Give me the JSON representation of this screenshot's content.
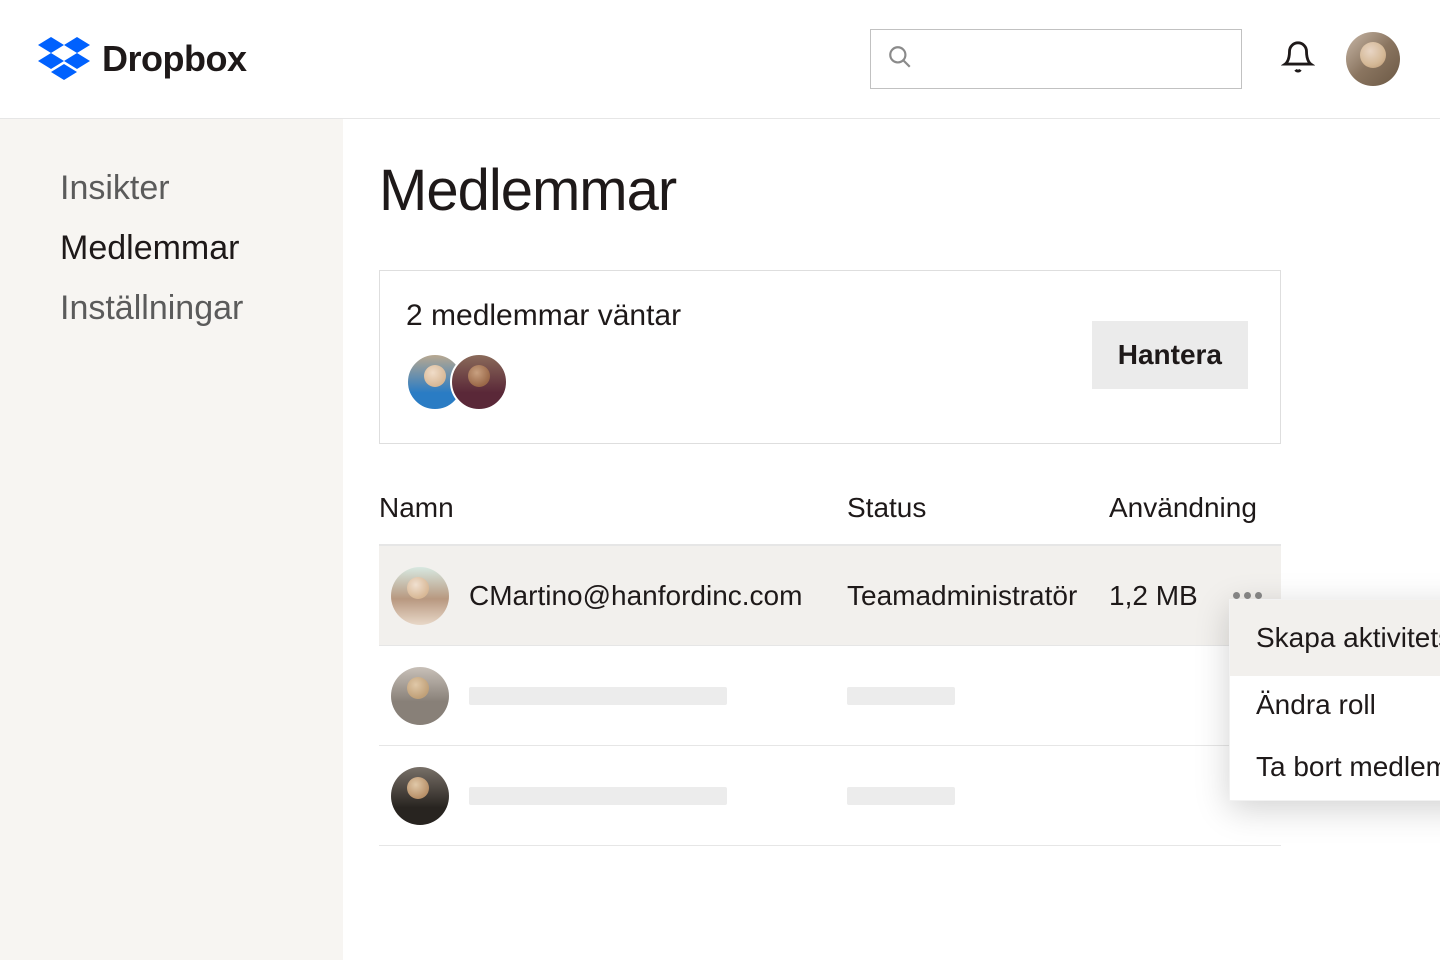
{
  "brand": "Dropbox",
  "sidebar": {
    "items": [
      {
        "label": "Insikter",
        "active": false
      },
      {
        "label": "Medlemmar",
        "active": true
      },
      {
        "label": "Inställningar",
        "active": false
      }
    ]
  },
  "page": {
    "title": "Medlemmar",
    "pending": {
      "text": "2 medlemmar väntar",
      "manage_label": "Hantera"
    },
    "table": {
      "headers": {
        "name": "Namn",
        "status": "Status",
        "usage": "Användning"
      },
      "rows": [
        {
          "name": "CMartino@hanfordinc.com",
          "status": "Teamadministratör",
          "usage": "1,2 MB"
        }
      ]
    }
  },
  "dropdown": {
    "items": [
      {
        "label": "Skapa aktivitetsrapport",
        "icon": "report-icon"
      },
      {
        "label": "Ändra roll",
        "icon": "gear-icon"
      },
      {
        "label": "Ta bort medlem",
        "icon": "trash-alert-icon"
      }
    ]
  }
}
